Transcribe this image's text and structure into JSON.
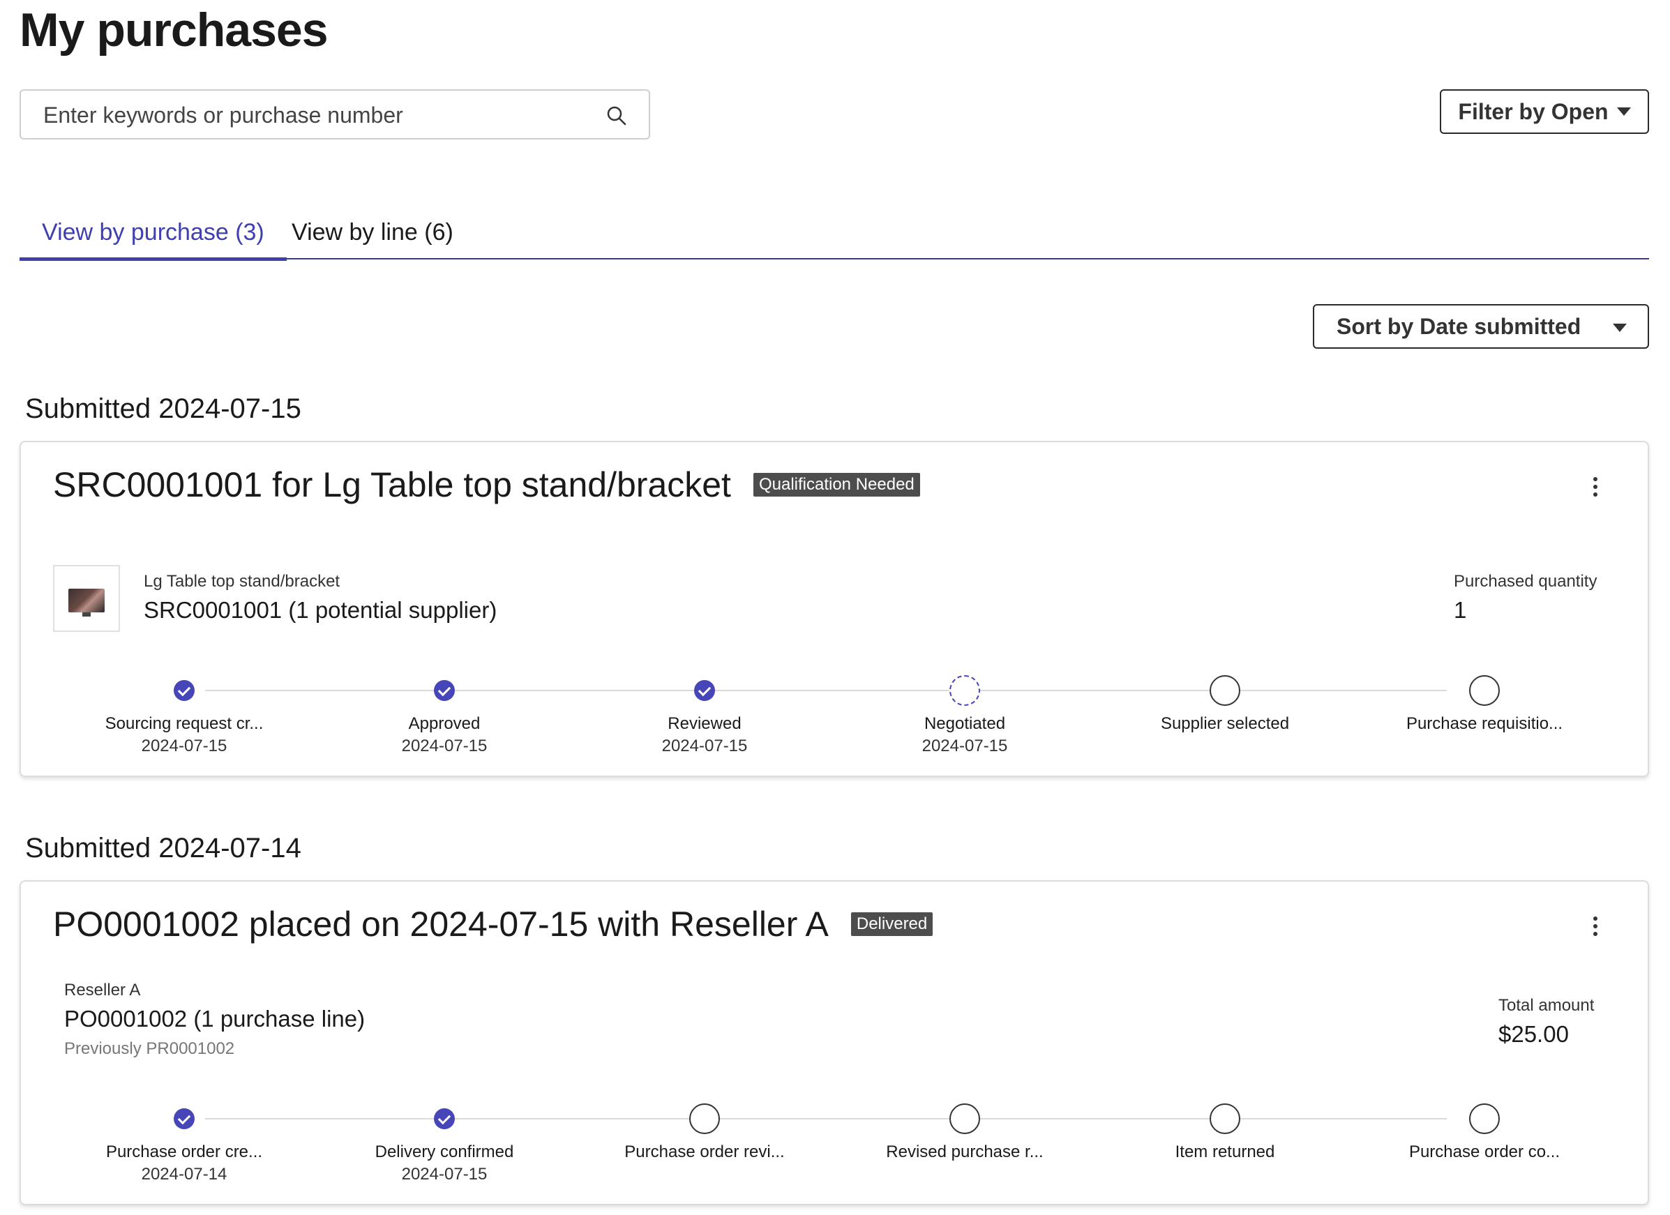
{
  "page_title": "My purchases",
  "search": {
    "placeholder": "Enter keywords or purchase number",
    "value": ""
  },
  "filter": {
    "label": "Filter by Open"
  },
  "tabs": [
    {
      "label": "View by purchase (3)",
      "active": true
    },
    {
      "label": "View by line (6)",
      "active": false
    }
  ],
  "sort": {
    "label": "Sort by Date submitted"
  },
  "groups": [
    {
      "heading": "Submitted 2024-07-15",
      "card": {
        "title": "SRC0001001 for Lg Table top stand/bracket",
        "badge": "Qualification Needed",
        "line_caption": "Lg Table top stand/bracket",
        "line_main": "SRC0001001 (1 potential supplier)",
        "metric_label": "Purchased quantity",
        "metric_value": "1",
        "steps": [
          {
            "label": "Sourcing request cr...",
            "date": "2024-07-15",
            "state": "done"
          },
          {
            "label": "Approved",
            "date": "2024-07-15",
            "state": "done"
          },
          {
            "label": "Reviewed",
            "date": "2024-07-15",
            "state": "done"
          },
          {
            "label": "Negotiated",
            "date": "2024-07-15",
            "state": "current"
          },
          {
            "label": "Supplier selected",
            "date": "",
            "state": "pending"
          },
          {
            "label": "Purchase requisitio...",
            "date": "",
            "state": "pending"
          }
        ]
      }
    },
    {
      "heading": "Submitted 2024-07-14",
      "card": {
        "title": "PO0001002 placed on 2024-07-15 with Reseller A",
        "badge": "Delivered",
        "line_caption": "Reseller A",
        "line_main": "PO0001002 (1 purchase line)",
        "line_sub": "Previously PR0001002",
        "metric_label": "Total amount",
        "metric_value": "$25.00",
        "steps": [
          {
            "label": "Purchase order cre...",
            "date": "2024-07-14",
            "state": "done"
          },
          {
            "label": "Delivery confirmed",
            "date": "2024-07-15",
            "state": "done"
          },
          {
            "label": "Purchase order revi...",
            "date": "",
            "state": "pending"
          },
          {
            "label": "Revised purchase r...",
            "date": "",
            "state": "pending"
          },
          {
            "label": "Item returned",
            "date": "",
            "state": "pending"
          },
          {
            "label": "Purchase order co...",
            "date": "",
            "state": "pending"
          }
        ]
      }
    }
  ]
}
